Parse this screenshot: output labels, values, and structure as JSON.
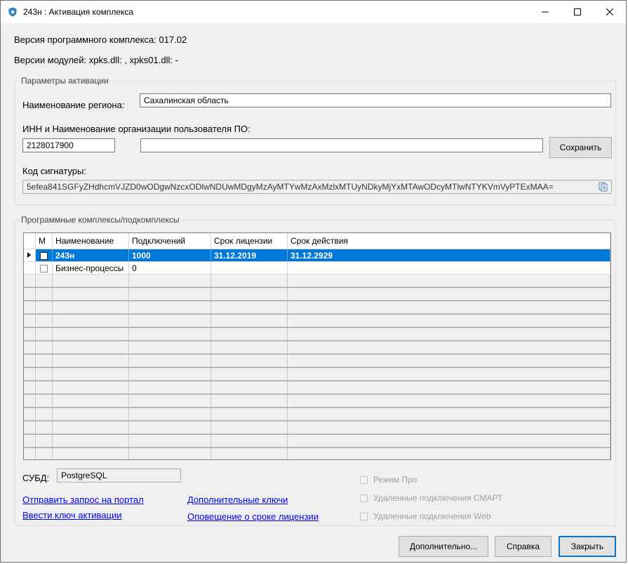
{
  "window": {
    "title": "243н : Активация комплекса"
  },
  "info": {
    "version_line": "Версия программного комплекса: 017.02",
    "modules_line": "Версии модулей: xpks.dll: , xpks01.dll: -"
  },
  "activation": {
    "legend": "Параметры активации",
    "region_label": "Наименование региона:",
    "region_value": "Сахалинская область",
    "inn_label": "ИНН и Наименование организации пользователя ПО:",
    "inn_value": "2128017900",
    "org_name_value": "",
    "save_label": "Сохранить",
    "signature_label": "Код сигнатуры:",
    "signature_value": "5efea841SGFyZHdhcmVJZD0wODgwNzcxODlwNDUwMDgyMzAyMTYwMzAxMzlxMTUyNDkyMjYxMTAwODcyMTlwNTYKVmVyPTExMAA="
  },
  "complexes": {
    "legend": "Программные комплексы/подкомплексы",
    "columns": [
      "М",
      "Наименование",
      "Подключений",
      "Срок лицензии",
      "Срок действия"
    ],
    "rows": [
      {
        "m": false,
        "name": "243н",
        "connections": "1000",
        "license_term": "31.12.2019",
        "validity_term": "31.12.2929",
        "selected": true
      },
      {
        "m": false,
        "name": "Бизнес-процессы",
        "connections": "0",
        "license_term": "",
        "validity_term": "",
        "selected": false
      }
    ]
  },
  "dbms": {
    "label": "СУБД:",
    "value": "PostgreSQL"
  },
  "links": {
    "send_request": "Отправить запрос на портал",
    "enter_key": "Ввести ключ активации",
    "extra_keys": "Дополнительные ключи",
    "license_notice": "Оповещение о сроке лицензии"
  },
  "options": {
    "pro_mode": "Режим Про",
    "remote_smart": "Удаленные подключения СМАРТ",
    "remote_web": "Удаленные подключения Web"
  },
  "buttons": {
    "more": "Дополнительно...",
    "help": "Справка",
    "close": "Закрыть"
  },
  "colors": {
    "accent": "#0078d7",
    "link": "#0000ee"
  }
}
